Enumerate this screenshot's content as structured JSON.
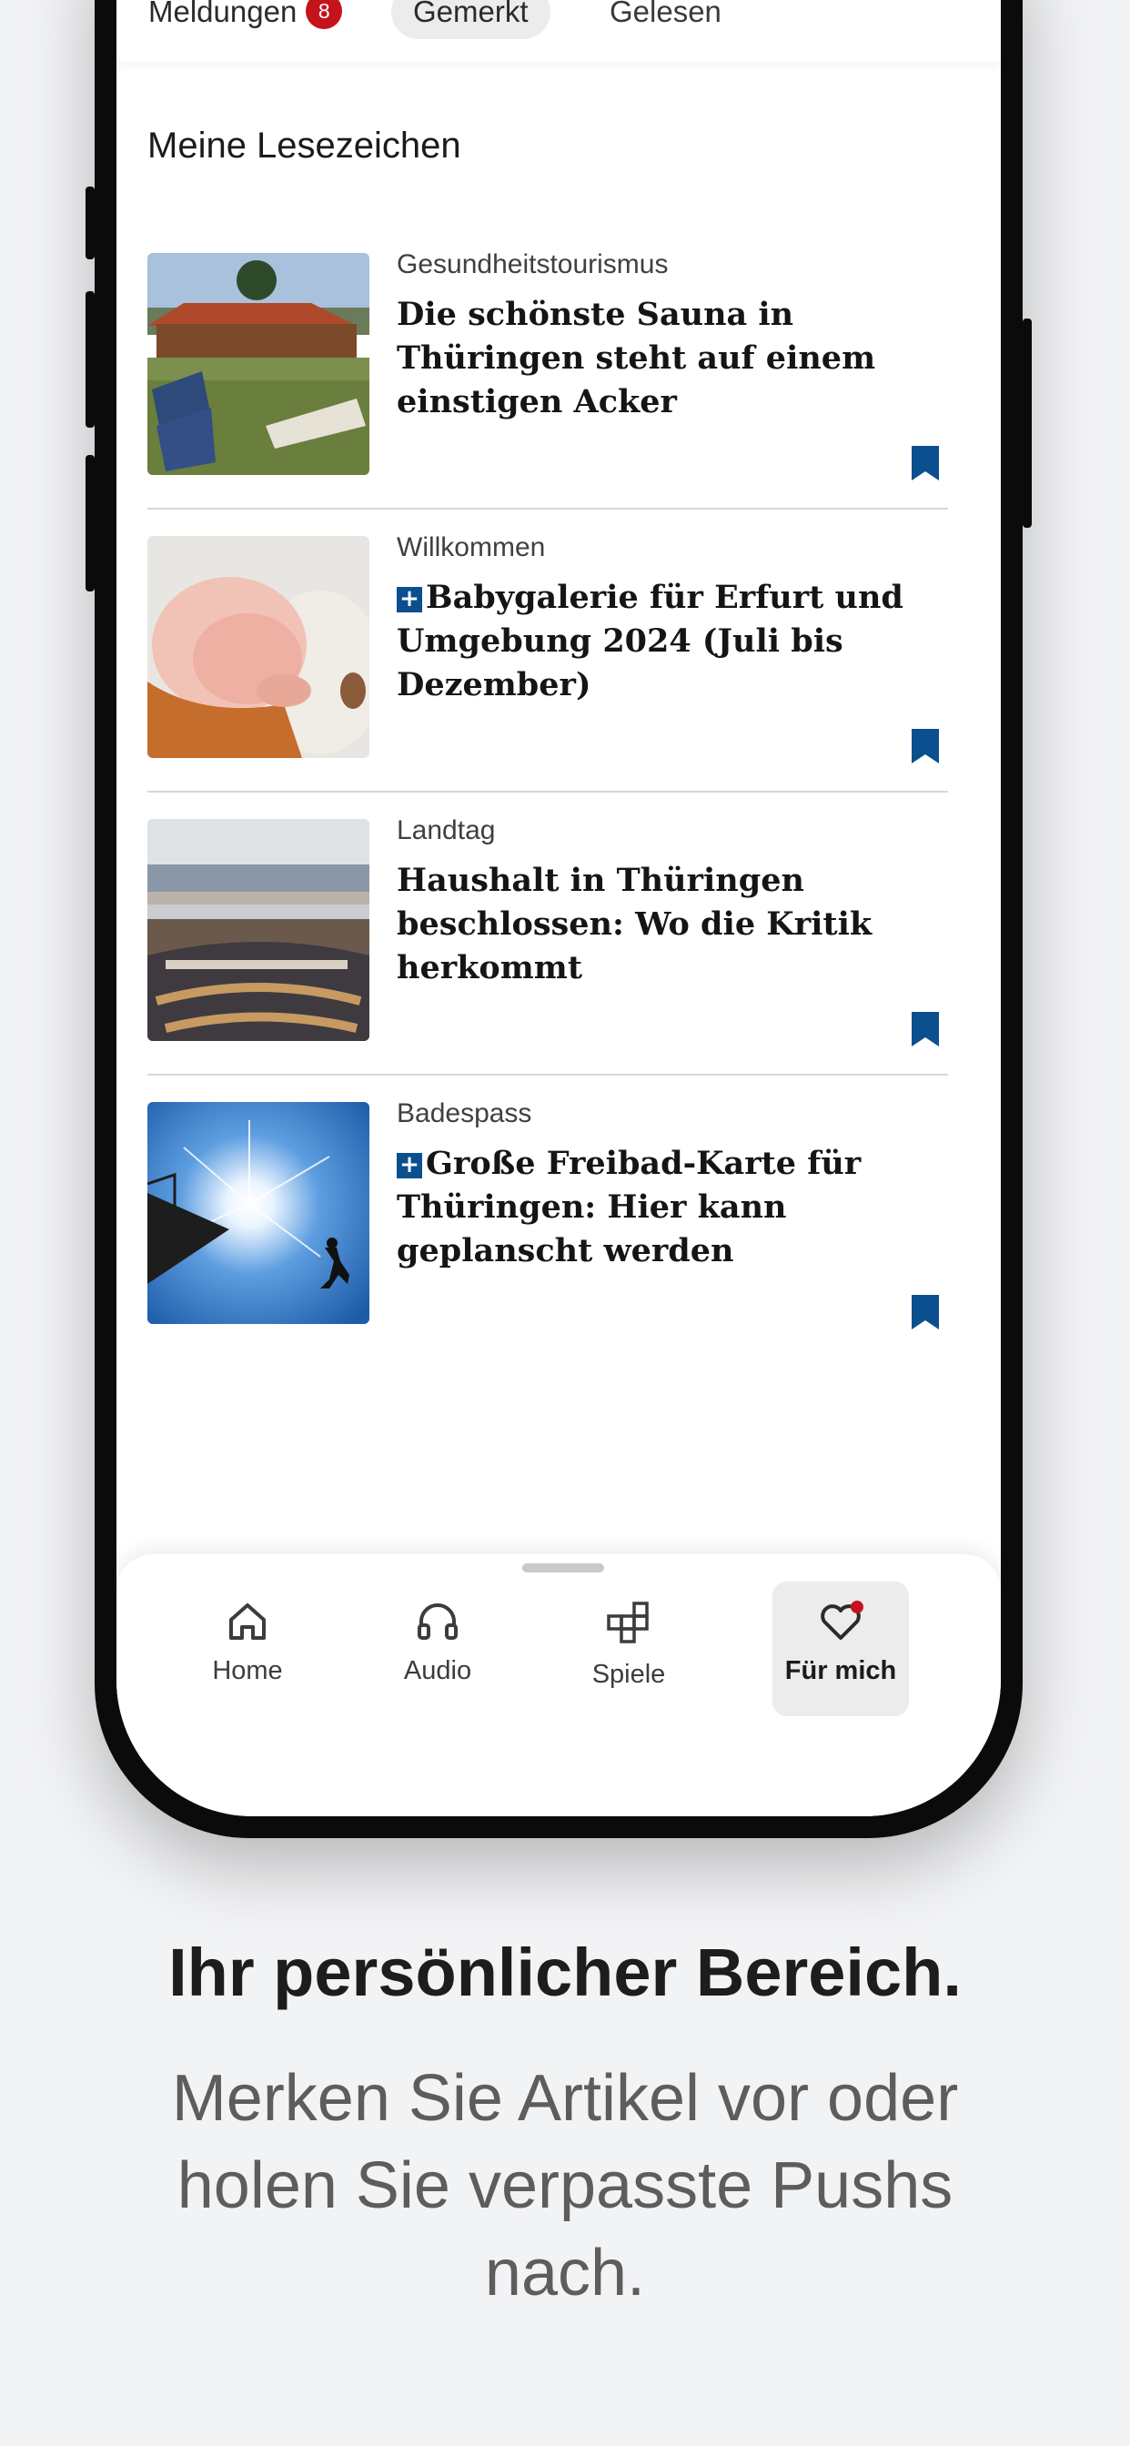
{
  "tabs": {
    "meldungen_label": "Meldungen",
    "meldungen_badge": "8",
    "gemerkt_label": "Gemerkt",
    "gelesen_label": "Gelesen"
  },
  "section_title": "Meine Lesezeichen",
  "articles": [
    {
      "kicker": "Gesundheitstourismus",
      "headline": "Die schönste Sauna in Thüringen steht auf einem einstigen Acker",
      "plus": false
    },
    {
      "kicker": "Willkommen",
      "headline": "Babygalerie für Erfurt und Umgebung 2024 (Juli bis Dezember)",
      "plus": true
    },
    {
      "kicker": "Landtag",
      "headline": "Haushalt in Thüringen beschlossen: Wo die Kritik herkommt",
      "plus": false
    },
    {
      "kicker": "Badespass",
      "headline": "Große Freibad-Karte für Thüringen: Hier kann geplanscht werden",
      "plus": true
    }
  ],
  "plus_symbol": "+",
  "nav": {
    "home": "Home",
    "audio": "Audio",
    "spiele": "Spiele",
    "fuer_mich": "Für mich"
  },
  "promo": {
    "title": "Ihr persönlicher Bereich.",
    "subtitle": "Merken Sie Artikel vor oder holen Sie verpasste Pushs nach."
  },
  "colors": {
    "accent_blue": "#0b4f8e",
    "badge_red": "#c4131b"
  }
}
